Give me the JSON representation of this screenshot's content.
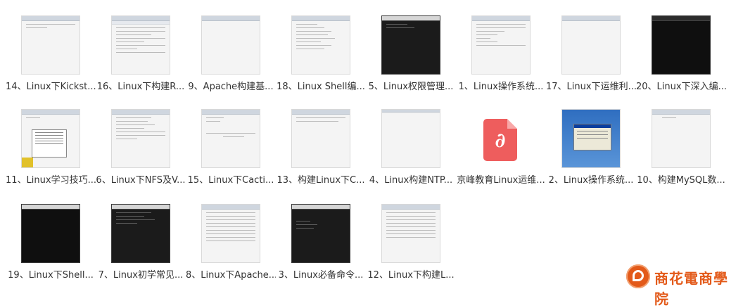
{
  "files": [
    {
      "label": "14、Linux下Kickst...",
      "thumb": "light"
    },
    {
      "label": "16、Linux下构建R...",
      "thumb": "doc"
    },
    {
      "label": "9、Apache构建基...",
      "thumb": "light"
    },
    {
      "label": "18、Linux Shell编...",
      "thumb": "doc"
    },
    {
      "label": "5、Linux权限管理...",
      "thumb": "terminal"
    },
    {
      "label": "1、Linux操作系统...",
      "thumb": "doc"
    },
    {
      "label": "17、Linux下运维利...",
      "thumb": "light"
    },
    {
      "label": "20、Linux下深入编...",
      "thumb": "dark"
    },
    {
      "label": "11、Linux学习技巧...",
      "thumb": "dialog"
    },
    {
      "label": "6、Linux下NFS及V...",
      "thumb": "doc"
    },
    {
      "label": "15、Linux下Cacti...",
      "thumb": "light"
    },
    {
      "label": "13、构建Linux下C...",
      "thumb": "light"
    },
    {
      "label": "4、Linux构建NTP...",
      "thumb": "light"
    },
    {
      "label": "京峰教育Linux运维...",
      "thumb": "pdf"
    },
    {
      "label": "2、Linux操作系统...",
      "thumb": "blue"
    },
    {
      "label": "10、构建MySQL数...",
      "thumb": "light"
    },
    {
      "label": "19、Linux下Shell...",
      "thumb": "dark"
    },
    {
      "label": "7、Linux初学常见...",
      "thumb": "terminal"
    },
    {
      "label": "8、Linux下Apache...",
      "thumb": "doc"
    },
    {
      "label": "3、Linux必备命令...",
      "thumb": "terminal"
    },
    {
      "label": "12、Linux下构建L...",
      "thumb": "doc"
    }
  ],
  "watermark": {
    "text": "商花電商學院",
    "icon": "logo-icon"
  }
}
